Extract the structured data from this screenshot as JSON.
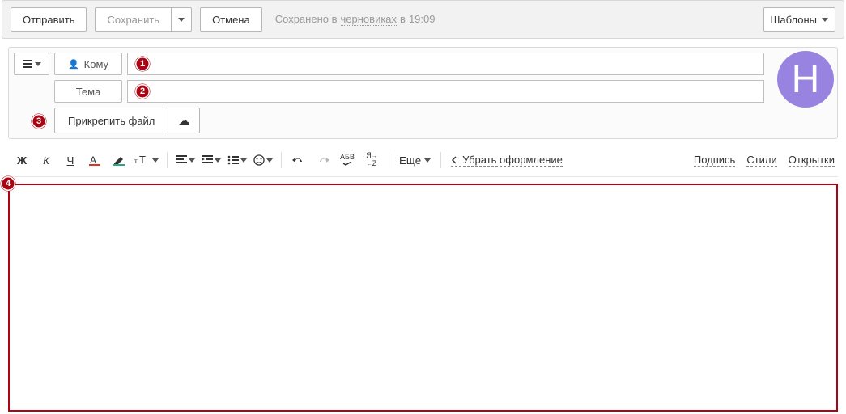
{
  "topbar": {
    "send": "Отправить",
    "save": "Сохранить",
    "cancel": "Отмена",
    "status_prefix": "Сохранено в",
    "status_drafts": "черновиках",
    "status_middle": "в",
    "status_time": "19:09",
    "templates": "Шаблоны"
  },
  "compose": {
    "to_label": "Кому",
    "to_value": "",
    "subject_label": "Тема",
    "subject_value": "",
    "attach_label": "Прикрепить файл",
    "avatar_letter": "Н"
  },
  "annotations": {
    "a1": "1",
    "a2": "2",
    "a3": "3",
    "a4": "4"
  },
  "fmt": {
    "bold": "Ж",
    "italic": "К",
    "underline": "Ч",
    "abv": "АБВ",
    "az": "Я",
    "az2": "Z",
    "more": "Еще",
    "clear": "Убрать оформление",
    "signature": "Подпись",
    "styles": "Стили",
    "postcards": "Открытки"
  },
  "editor": {
    "content": ""
  }
}
